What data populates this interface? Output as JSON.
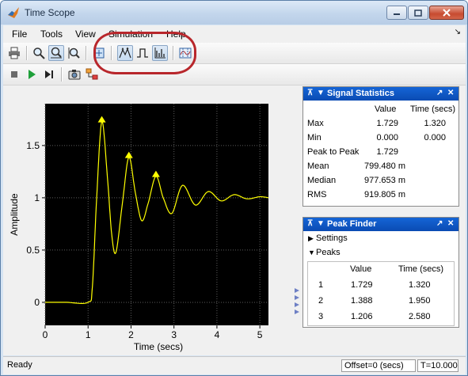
{
  "window": {
    "title": "Time Scope"
  },
  "menu": {
    "items": [
      "File",
      "Tools",
      "View",
      "Simulation",
      "Help"
    ],
    "arrow": "↘"
  },
  "toolbar": {
    "row1_icons": [
      "print-icon",
      "zoom-in-icon",
      "zoom-x-icon",
      "zoom-y-icon",
      "scale-axes-icon",
      "peak-finder-icon",
      "bilevel-measurements-icon",
      "signal-statistics-icon",
      "cursor-measurements-icon"
    ],
    "row2_icons": [
      "stop-icon",
      "run-icon",
      "step-forward-icon",
      "snapshot-icon",
      "highlight-simulink-block-icon"
    ]
  },
  "chart_data": {
    "type": "line",
    "xlabel": "Time (secs)",
    "ylabel": "Amplitude",
    "xlim": [
      0,
      5.2
    ],
    "ylim": [
      -0.22,
      1.9
    ],
    "xticks": [
      "0",
      "1",
      "2",
      "3",
      "4",
      "5"
    ],
    "yticks": [
      "0",
      "0.5",
      "1",
      "1.5"
    ],
    "grid": true,
    "background": "#000000",
    "series": [
      {
        "color": "#ffff00",
        "x": [
          0,
          0.5,
          1.0,
          1.1,
          1.2,
          1.32,
          1.45,
          1.55,
          1.65,
          1.8,
          1.95,
          2.1,
          2.25,
          2.4,
          2.58,
          2.75,
          2.95,
          3.2,
          3.5,
          3.8,
          4.1,
          4.4,
          4.7,
          5.0,
          5.2
        ],
        "y": [
          0,
          0,
          0,
          0.15,
          1.0,
          1.729,
          1.2,
          0.65,
          0.48,
          0.95,
          1.388,
          1.05,
          0.78,
          0.95,
          1.206,
          1.0,
          0.85,
          1.12,
          0.93,
          1.06,
          0.97,
          1.03,
          0.99,
          1.01,
          1.0
        ]
      }
    ],
    "peaks": [
      {
        "x": 1.32,
        "y": 1.729
      },
      {
        "x": 1.95,
        "y": 1.388
      },
      {
        "x": 2.58,
        "y": 1.206
      }
    ]
  },
  "signal_statistics": {
    "title": "Signal Statistics",
    "col_value": "Value",
    "col_time": "Time (secs)",
    "rows": [
      {
        "label": "Max",
        "value": "1.729",
        "time": "1.320"
      },
      {
        "label": "Min",
        "value": "0.000",
        "time": "0.000"
      },
      {
        "label": "Peak to Peak",
        "value": "1.729",
        "time": ""
      },
      {
        "label": "Mean",
        "value": "799.480 m",
        "time": ""
      },
      {
        "label": "Median",
        "value": "977.653 m",
        "time": ""
      },
      {
        "label": "RMS",
        "value": "919.805 m",
        "time": ""
      }
    ]
  },
  "peak_finder": {
    "title": "Peak Finder",
    "settings_label": "Settings",
    "peaks_label": "Peaks",
    "col_value": "Value",
    "col_time": "Time (secs)",
    "rows": [
      {
        "index": "1",
        "value": "1.729",
        "time": "1.320"
      },
      {
        "index": "2",
        "value": "1.388",
        "time": "1.950"
      },
      {
        "index": "3",
        "value": "1.206",
        "time": "2.580"
      }
    ]
  },
  "status": {
    "ready": "Ready",
    "offset": "Offset=0 (secs)",
    "time": "T=10.000"
  },
  "colors": {
    "accent": "#0a4bb3",
    "highlight_ring": "#b8272c",
    "signal": "#ffff00"
  }
}
